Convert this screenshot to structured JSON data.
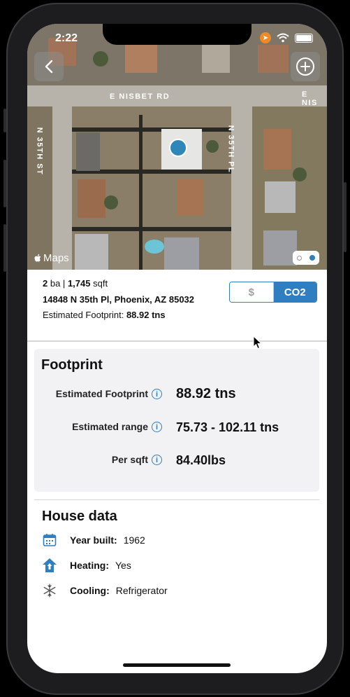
{
  "status_bar": {
    "time": "2:22"
  },
  "map": {
    "streets": {
      "top": "E NISBET RD",
      "top_right": "E NIS",
      "left": "N 35TH ST",
      "right": "N 35TH PL"
    },
    "attribution": "Maps"
  },
  "property": {
    "baths": "2",
    "baths_unit": "ba |",
    "sqft": "1,745",
    "sqft_unit": "sqft",
    "address": "14848 N 35th Pl, Phoenix, AZ 85032",
    "footprint_label": "Estimated Footprint:",
    "footprint_value": "88.92 tns"
  },
  "toggle": {
    "options": [
      "$",
      "CO2"
    ],
    "selected": "CO2"
  },
  "footprint": {
    "title": "Footprint",
    "rows": [
      {
        "label": "Estimated Footprint",
        "value": "88.92 tns"
      },
      {
        "label": "Estimated range",
        "value": "75.73 - 102.11 tns"
      },
      {
        "label": "Per sqft",
        "value": "84.40lbs"
      }
    ]
  },
  "house_data": {
    "title": "House data",
    "rows": [
      {
        "icon": "calendar-icon",
        "label": "Year built:",
        "value": "1962"
      },
      {
        "icon": "heating-icon",
        "label": "Heating:",
        "value": "Yes"
      },
      {
        "icon": "snowflake-icon",
        "label": "Cooling:",
        "value": "Refrigerator"
      }
    ]
  },
  "colors": {
    "accent": "#2f7ec1",
    "card": "#f2f2f4",
    "pin": "#2f86b8"
  }
}
